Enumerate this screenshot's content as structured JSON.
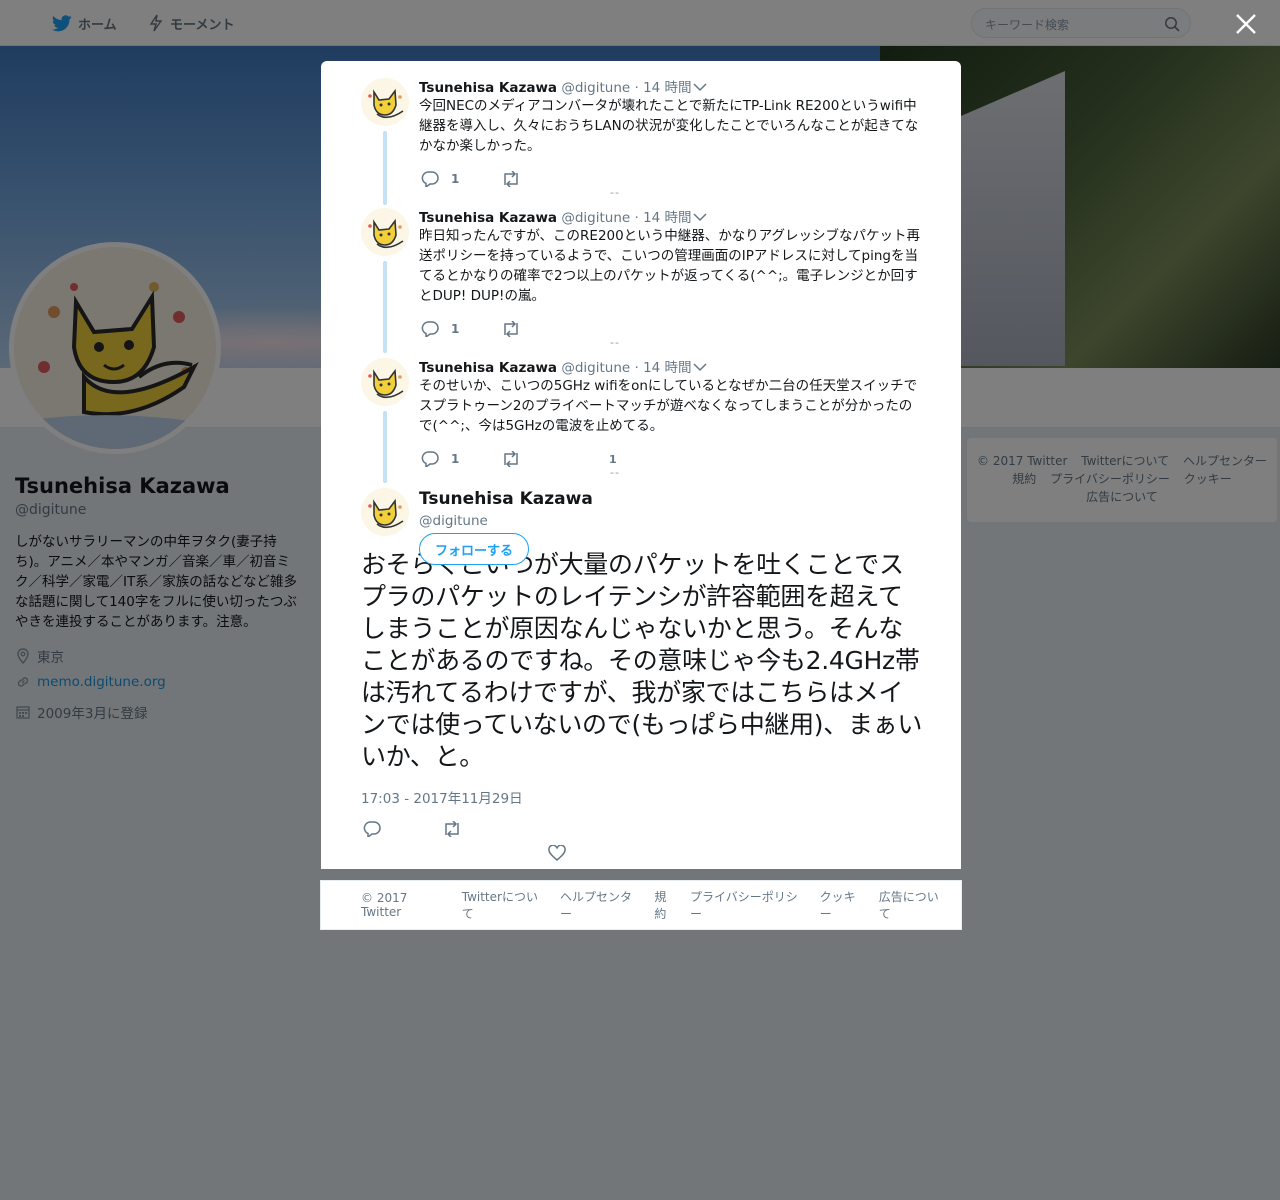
{
  "topnav": {
    "home_label": "ホーム",
    "moments_label": "モーメント",
    "search_placeholder": "キーワード検索"
  },
  "profile": {
    "name": "Tsunehisa Kazawa",
    "handle": "@digitune",
    "bio": "しがないサラリーマンの中年ヲタク(妻子持ち)。アニメ／本やマンガ／音楽／車／初音ミク／科学／家電／IT系／家族の話などなど雑多な話題に関して140字をフルに使い切ったつぶやきを連投することがあります。注意。",
    "location": "東京",
    "url": "memo.digitune.org",
    "joined": "2009年3月に登録"
  },
  "side_footer": [
    "© 2017 Twitter",
    "Twitterについて",
    "ヘルプセンター",
    "規約",
    "プライバシーポリシー",
    "クッキー",
    "広告について"
  ],
  "tweets": [
    {
      "name": "Tsunehisa Kazawa",
      "handle": "@digitune",
      "time": "· 14 時間",
      "text": "今回NECのメディアコンバータが壊れたことで新たにTP-Link RE200というwifi中継器を導入し、久々におうちLANの状況が変化したことでいろんなことが起きてなかなか楽しかった。",
      "reply_count": "1"
    },
    {
      "name": "Tsunehisa Kazawa",
      "handle": "@digitune",
      "time": "· 14 時間",
      "text": "昨日知ったんですが、このRE200という中継器、かなりアグレッシブなパケット再送ポリシーを持っているようで、こいつの管理画面のIPアドレスに対してpingを当てるとかなりの確率で2つ以上のパケットが返ってくる(^^;。電子レンジとか回すとDUP! DUP!の嵐。",
      "reply_count": "1"
    },
    {
      "name": "Tsunehisa Kazawa",
      "handle": "@digitune",
      "time": "· 14 時間",
      "text": "そのせいか、こいつの5GHz wifiをonにしているとなぜか二台の任天堂スイッチでスプラトゥーン2のプライベートマッチが遊べなくなってしまうことが分かったので(^^;、今は5GHzの電波を止めてる。",
      "reply_count": "1",
      "extra_count": "1"
    }
  ],
  "separator": "--",
  "main_tweet": {
    "name": "Tsunehisa Kazawa",
    "handle": "@digitune",
    "follow_label": "フォローする",
    "text": "おそらくこいつが大量のパケットを吐くことでスプラのパケットのレイテンシが許容範囲を超えてしまうことが原因なんじゃないかと思う。そんなことがあるのですね。その意味じゃ今も2.4GHz帯は汚れてるわけですが、我が家ではこちらはメインでは使っていないので(もっぱら中継用)、まぁいいか、と。",
    "date": "17:03 - 2017年11月29日"
  },
  "footer": [
    "© 2017 Twitter",
    "Twitterについて",
    "ヘルプセンター",
    "規約",
    "プライバシーポリシー",
    "クッキー",
    "広告について"
  ],
  "colors": {
    "accent": "#1da1f2",
    "link": "#1b95e0",
    "muted": "#657786",
    "thread_line": "#c4e1f5"
  }
}
